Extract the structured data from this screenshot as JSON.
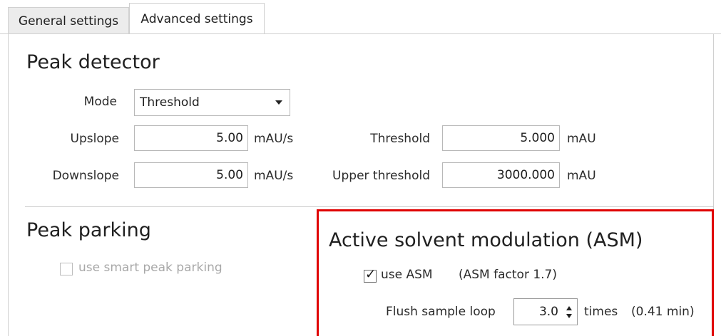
{
  "tabs": {
    "general": "General settings",
    "advanced": "Advanced settings"
  },
  "peak_detector": {
    "title": "Peak detector",
    "mode_label": "Mode",
    "mode_value": "Threshold",
    "upslope_label": "Upslope",
    "upslope_value": "5.00",
    "upslope_unit": "mAU/s",
    "downslope_label": "Downslope",
    "downslope_value": "5.00",
    "downslope_unit": "mAU/s",
    "threshold_label": "Threshold",
    "threshold_value": "5.000",
    "threshold_unit": "mAU",
    "upper_threshold_label": "Upper threshold",
    "upper_threshold_value": "3000.000",
    "upper_threshold_unit": "mAU"
  },
  "peak_parking": {
    "title": "Peak parking",
    "checkbox_label": "use smart peak parking",
    "checked": false,
    "enabled": false
  },
  "asm": {
    "title": "Active solvent modulation (ASM)",
    "checkbox_label": "use ASM",
    "checked": true,
    "factor_text": "(ASM factor 1.7)",
    "flush_label": "Flush sample loop",
    "flush_value": "3.0",
    "flush_unit": "times",
    "flush_duration": "(0.41 min)",
    "highlight_color": "#e00000"
  },
  "icons": {
    "dropdown": "chevron-down-icon",
    "spin_up": "spin-up-icon",
    "spin_down": "spin-down-icon",
    "check": "checkmark-icon"
  }
}
